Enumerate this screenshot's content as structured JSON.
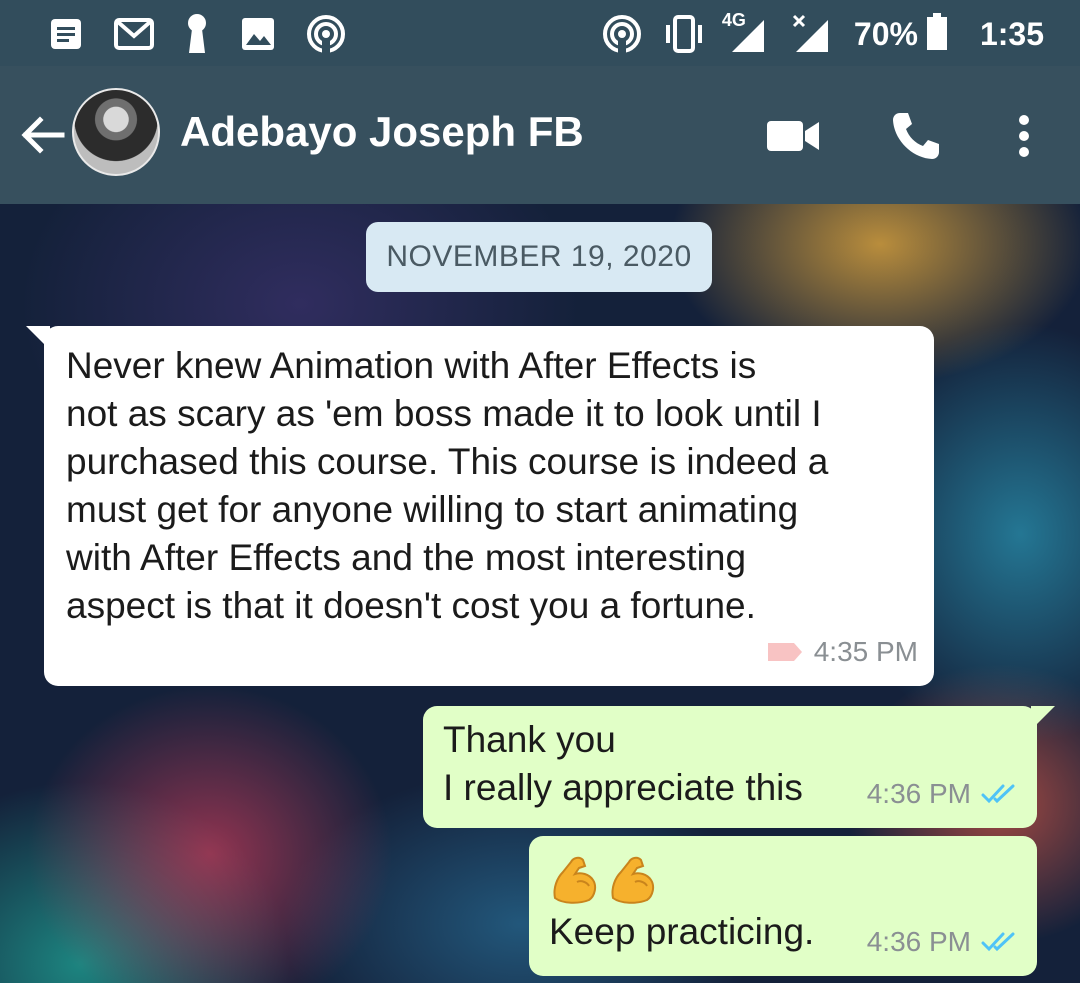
{
  "status_bar": {
    "left_icons": [
      "notes-icon",
      "gmail-icon",
      "keyhole-icon",
      "gallery-icon",
      "hotspot-icon"
    ],
    "right_icons": [
      "hotspot-icon",
      "vibrate-icon",
      "signal-4g-icon",
      "signal-x-icon"
    ],
    "network_label": "4G",
    "battery_percent": "70%",
    "time": "1:35"
  },
  "header": {
    "contact_name": "Adebayo Joseph FB",
    "icons": [
      "back-arrow-icon",
      "avatar",
      "video-call-icon",
      "phone-icon",
      "more-vert-icon"
    ]
  },
  "chat": {
    "date_chip": "NOVEMBER 19, 2020",
    "messages": [
      {
        "direction": "incoming",
        "text": "Never knew Animation with After Effects is\nnot as scary as 'em boss made it to look until I\npurchased this course. This course is indeed a\nmust get for anyone willing to start animating\nwith After Effects and the most interesting\naspect is that it doesn't cost you a fortune.",
        "time": "4:35 PM",
        "label_icon": "label-icon",
        "label_color": "#f8c3c3"
      },
      {
        "direction": "outgoing",
        "text": "Thank you\nI really appreciate this",
        "time": "4:36 PM",
        "status": "read",
        "ticks_color": "#4fc3f7"
      },
      {
        "direction": "outgoing",
        "emojis": [
          "flexed-biceps-icon",
          "flexed-biceps-icon"
        ],
        "text": "Keep practicing.",
        "time": "4:36 PM",
        "status": "read",
        "ticks_color": "#4fc3f7"
      }
    ]
  },
  "colors": {
    "status_bar_bg": "#324d5c",
    "header_bg": "#37505e",
    "incoming_bubble": "#ffffff",
    "outgoing_bubble": "#e1ffc7",
    "date_chip_bg": "#d8e9f3"
  }
}
